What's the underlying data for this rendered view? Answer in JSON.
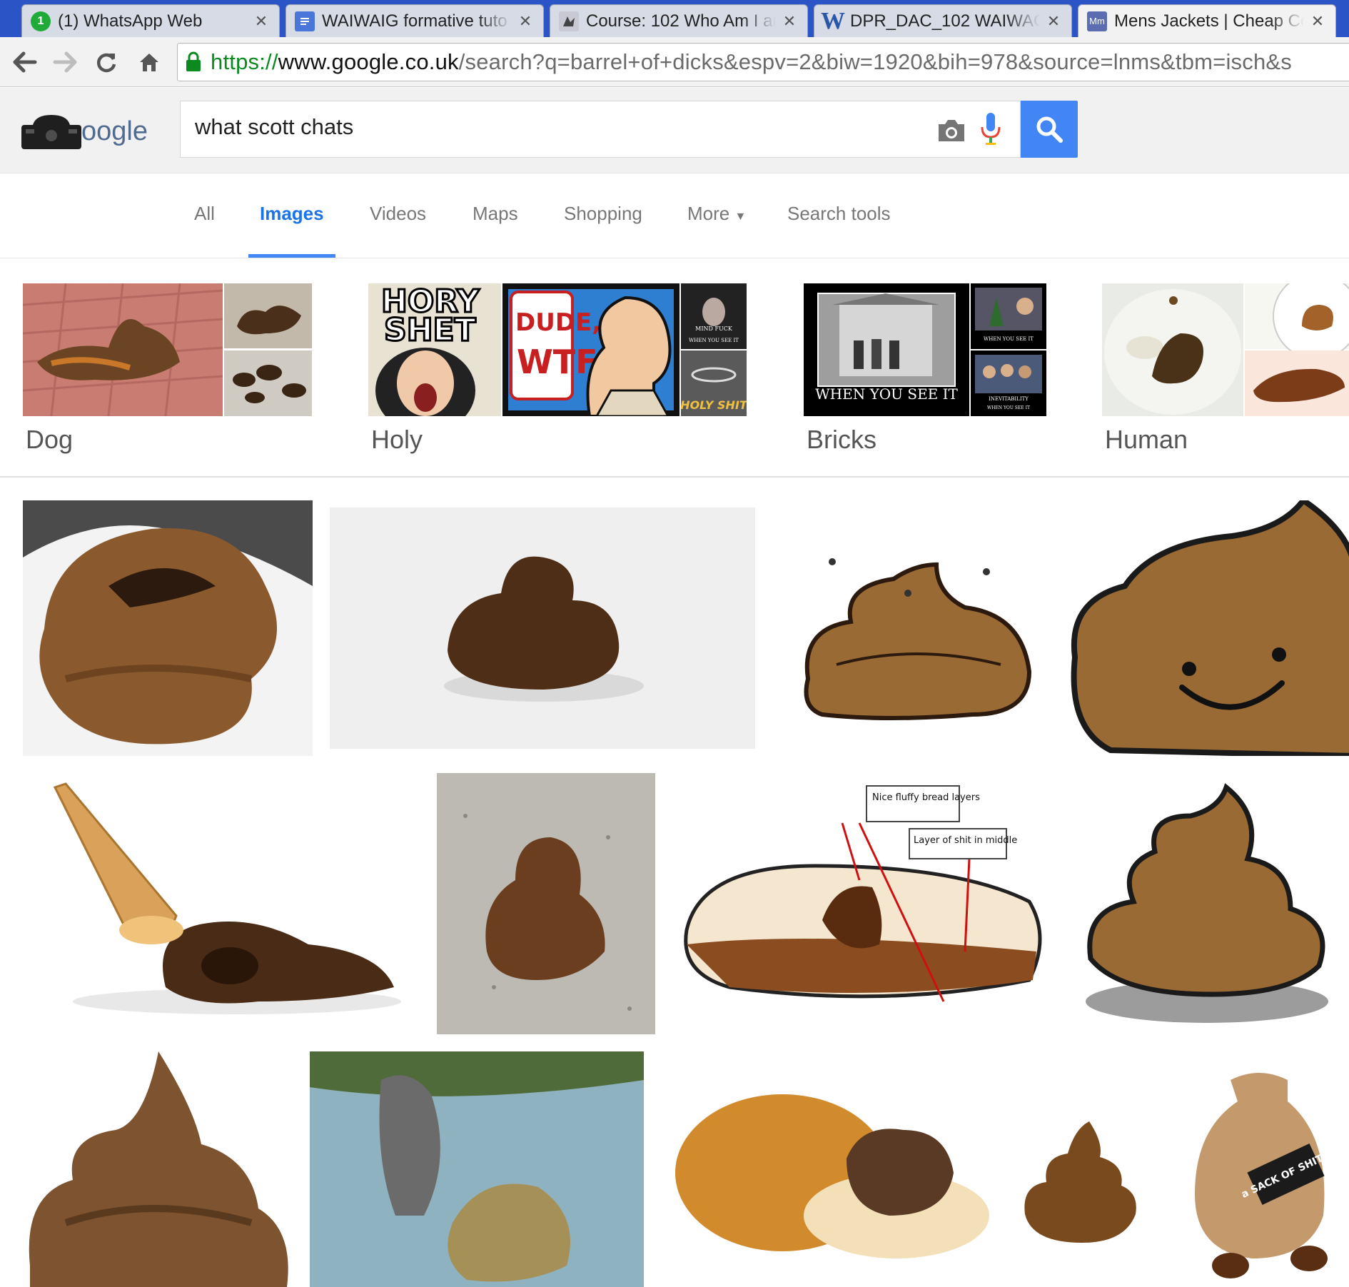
{
  "tabs": [
    {
      "title": "(1) WhatsApp Web",
      "favicon": "whatsapp-icon",
      "badge": "1"
    },
    {
      "title": "WAIWAIG formative tuto",
      "favicon": "docs-icon"
    },
    {
      "title": "Course: 102 Who Am I ar",
      "favicon": "moodle-icon"
    },
    {
      "title": "DPR_DAC_102 WAIWAG",
      "favicon": "word-icon",
      "badge": "W"
    },
    {
      "title": "Mens Jackets | Cheap Co",
      "favicon": "mm-icon",
      "badge": "Mm"
    }
  ],
  "address": {
    "scheme": "https://",
    "host": "www.google.co.uk",
    "path": "/search?q=barrel+of+dicks&espv=2&biw=1920&bih=978&source=lnms&tbm=isch&s"
  },
  "logo_text": "oogle",
  "search": {
    "query": "what scott chats"
  },
  "nav": {
    "all": "All",
    "images": "Images",
    "videos": "Videos",
    "maps": "Maps",
    "shopping": "Shopping",
    "more": "More",
    "search_tools": "Search tools"
  },
  "related": [
    {
      "label": "Dog"
    },
    {
      "label": "Holy"
    },
    {
      "label": "Bricks"
    },
    {
      "label": "Human"
    }
  ],
  "meme_text": {
    "hory": "HORY",
    "shet": "SHET",
    "dude": "DUDE,",
    "wtf": "WTF?",
    "holy_shit": "HOLY SHIT",
    "when_you_see_it": "WHEN YOU SEE IT",
    "mind_fuck": "MIND FUCK",
    "inevitability": "INEVITABILITY"
  },
  "diagram_labels": {
    "bread": "Nice fluffy bread layers",
    "middle": "Layer of shit in middle"
  },
  "bag_text": "a SACK OF SHIT",
  "colors": {
    "tabstrip": "#2b55c7",
    "accent": "#4285f4",
    "poo_brown": "#7a4a1f"
  }
}
